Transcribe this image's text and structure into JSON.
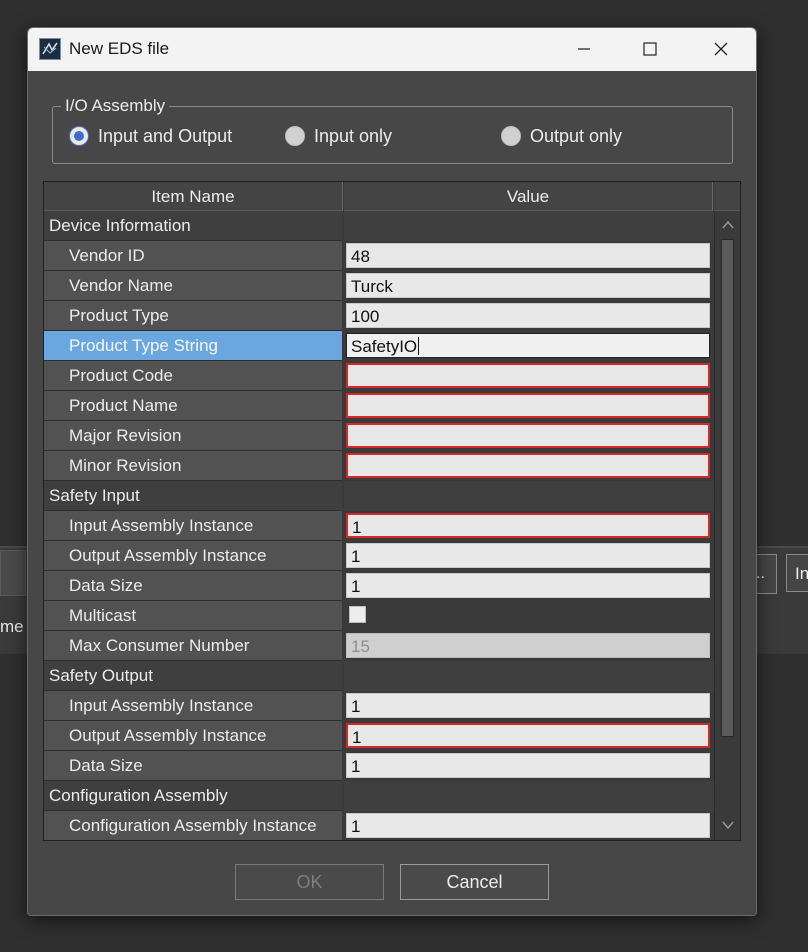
{
  "background": {
    "left_text": "me",
    "right_button_1": "..",
    "right_button_2": "In"
  },
  "dialog": {
    "title": "New EDS file",
    "icon": "ndp-app-icon",
    "controls": {
      "minimize": "minimize-icon",
      "maximize": "maximize-icon",
      "close": "close-icon"
    }
  },
  "io_assembly": {
    "legend": "I/O Assembly",
    "options": [
      {
        "label": "Input and Output",
        "selected": true
      },
      {
        "label": "Input only",
        "selected": false
      },
      {
        "label": "Output only",
        "selected": false
      }
    ]
  },
  "grid": {
    "headers": {
      "name": "Item Name",
      "value": "Value"
    },
    "rows": [
      {
        "name": "Device Information",
        "kind": "category"
      },
      {
        "name": "Vendor ID",
        "kind": "item",
        "value": "48",
        "state": "normal"
      },
      {
        "name": "Vendor Name",
        "kind": "item",
        "value": "Turck",
        "state": "normal"
      },
      {
        "name": "Product Type",
        "kind": "item",
        "value": "100",
        "state": "normal"
      },
      {
        "name": "Product Type String",
        "kind": "item",
        "value": "SafetyIO",
        "state": "focused",
        "selected": true
      },
      {
        "name": "Product Code",
        "kind": "item",
        "value": "",
        "state": "error"
      },
      {
        "name": "Product Name",
        "kind": "item",
        "value": "",
        "state": "error"
      },
      {
        "name": "Major Revision",
        "kind": "item",
        "value": "",
        "state": "error"
      },
      {
        "name": "Minor Revision",
        "kind": "item",
        "value": "",
        "state": "error"
      },
      {
        "name": "Safety Input",
        "kind": "category"
      },
      {
        "name": "Input Assembly Instance",
        "kind": "item",
        "value": "1",
        "state": "error"
      },
      {
        "name": "Output Assembly Instance",
        "kind": "item",
        "value": "1",
        "state": "normal"
      },
      {
        "name": "Data Size",
        "kind": "item",
        "value": "1",
        "state": "normal"
      },
      {
        "name": "Multicast",
        "kind": "item",
        "value": "",
        "state": "checkbox",
        "checked": false
      },
      {
        "name": "Max Consumer Number",
        "kind": "item",
        "value": "15",
        "state": "disabled"
      },
      {
        "name": "Safety Output",
        "kind": "category"
      },
      {
        "name": "Input Assembly Instance",
        "kind": "item",
        "value": "1",
        "state": "normal"
      },
      {
        "name": "Output Assembly Instance",
        "kind": "item",
        "value": "1",
        "state": "error"
      },
      {
        "name": "Data Size",
        "kind": "item",
        "value": "1",
        "state": "normal"
      },
      {
        "name": "Configuration Assembly",
        "kind": "category"
      },
      {
        "name": "Configuration Assembly Instance",
        "kind": "item",
        "value": "1",
        "state": "normal"
      }
    ]
  },
  "buttons": {
    "ok": "OK",
    "cancel": "Cancel"
  },
  "colors": {
    "selection": "#6aa6e0",
    "error_border": "#d62828",
    "radio_accent": "#3f6cc8"
  }
}
